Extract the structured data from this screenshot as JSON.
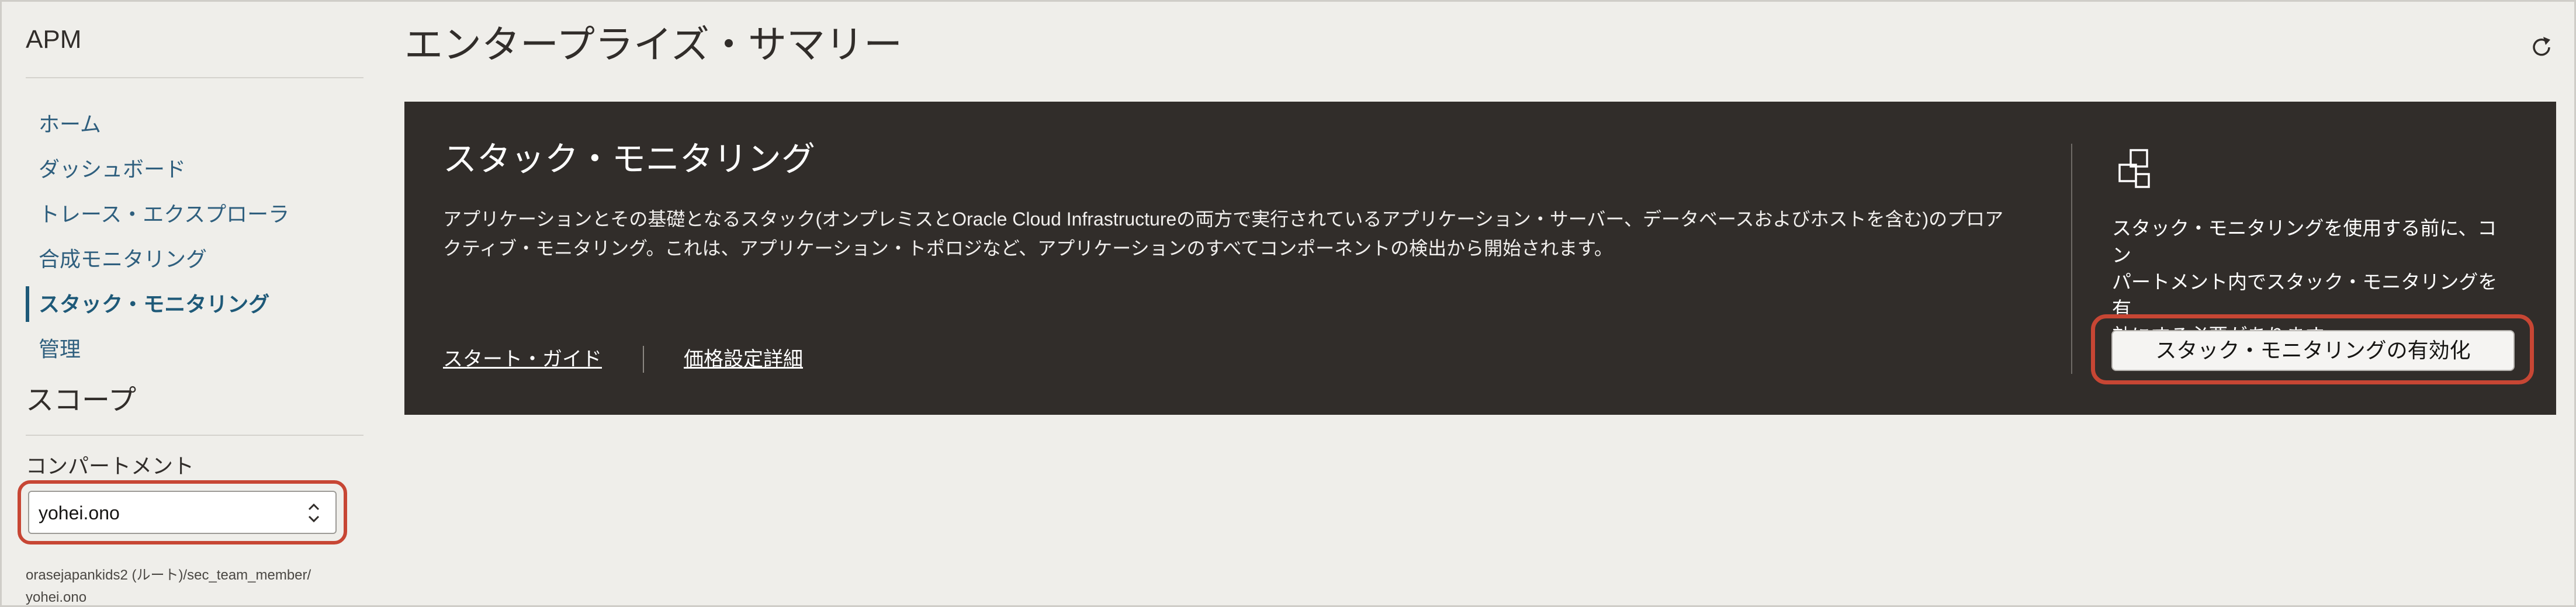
{
  "sidebar": {
    "app_title": "APM",
    "nav_items": [
      {
        "label": "ホーム"
      },
      {
        "label": "ダッシュボード"
      },
      {
        "label": "トレース・エクスプローラ"
      },
      {
        "label": "合成モニタリング"
      },
      {
        "label": "スタック・モニタリング",
        "active": true
      },
      {
        "label": "管理"
      }
    ],
    "scope_title": "スコープ",
    "compartment_label": "コンパートメント",
    "compartment_value": "yohei.ono",
    "compartment_path_line1": "orasejapankids2 (ルート)/sec_team_member/",
    "compartment_path_line2": "yohei.ono"
  },
  "main": {
    "page_title": "エンタープライズ・サマリー",
    "panel": {
      "title": "スタック・モニタリング",
      "description_line1": "アプリケーションとその基礎となるスタック(オンプレミスとOracle Cloud Infrastructureの両方で実行されているアプリケーション・サーバー、データベースおよびホストを含む)のプロア",
      "description_line2": "クティブ・モニタリング。これは、アプリケーション・トポロジなど、アプリケーションのすべてコンポーネントの検出から開始されます。",
      "link_start": "スタート・ガイド",
      "link_pricing": "価格設定詳細",
      "side_text_line1": "スタック・モニタリングを使用する前に、コン",
      "side_text_line2": "パートメント内でスタック・モニタリングを有",
      "side_text_line3": "効にする必要があります。",
      "enable_button": "スタック・モニタリングの有効化"
    }
  },
  "colors": {
    "accent": "#1e5978",
    "highlight": "#c74634",
    "panel_bg": "#312d2a",
    "page_bg": "#efeeea"
  },
  "icons": {
    "refresh": "refresh-icon",
    "select": "chevron-up-down-icon",
    "panel": "stack-boxes-icon"
  }
}
